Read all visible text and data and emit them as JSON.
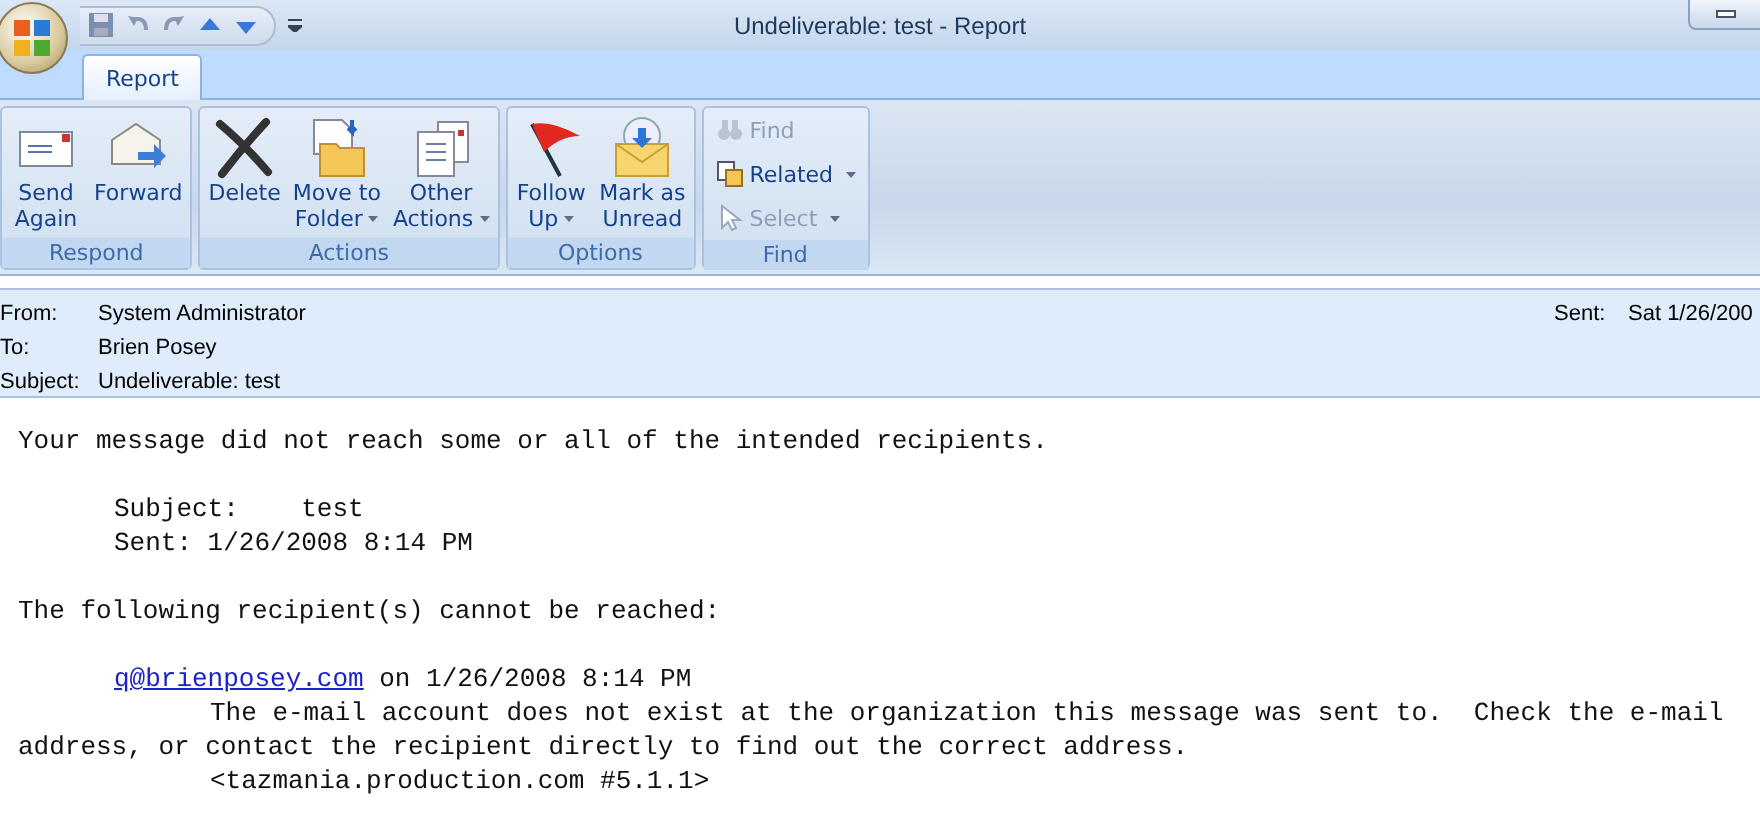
{
  "window": {
    "title": "Undeliverable: test - Report"
  },
  "tabs": [
    {
      "label": "Report",
      "selected": true
    }
  ],
  "ribbon": [
    {
      "label": "Respond",
      "buttons": [
        {
          "lines": [
            "Send",
            "Again"
          ],
          "dropdown": false
        },
        {
          "lines": [
            "Forward"
          ],
          "dropdown": false
        }
      ]
    },
    {
      "label": "Actions",
      "buttons": [
        {
          "lines": [
            "Delete"
          ],
          "dropdown": false
        },
        {
          "lines": [
            "Move to",
            "Folder"
          ],
          "dropdown": true
        },
        {
          "lines": [
            "Other",
            "Actions"
          ],
          "dropdown": true
        }
      ]
    },
    {
      "label": "Options",
      "buttons": [
        {
          "lines": [
            "Follow",
            "Up"
          ],
          "dropdown": true
        },
        {
          "lines": [
            "Mark as",
            "Unread"
          ],
          "dropdown": false
        }
      ]
    },
    {
      "label": "Find",
      "small": [
        {
          "label": "Find",
          "disabled": true,
          "dropdown": false
        },
        {
          "label": "Related",
          "disabled": false,
          "dropdown": true
        },
        {
          "label": "Select",
          "disabled": true,
          "dropdown": true
        }
      ]
    }
  ],
  "header": {
    "from_label": "From:",
    "from": "System Administrator",
    "to_label": "To:",
    "to": "Brien Posey",
    "subject_label": "Subject:",
    "subject": "Undeliverable: test",
    "sent_label": "Sent:",
    "sent": "Sat 1/26/200"
  },
  "body": [
    {
      "kind": "plain",
      "text": "Your message did not reach some or all of the intended recipients."
    },
    {
      "kind": "gap"
    },
    {
      "kind": "indent",
      "text": "Subject:    test"
    },
    {
      "kind": "indent",
      "text": "Sent: 1/26/2008 8:14 PM"
    },
    {
      "kind": "gap"
    },
    {
      "kind": "plain",
      "text": "The following recipient(s) cannot be reached:"
    },
    {
      "kind": "gap"
    },
    {
      "kind": "recipient",
      "link": "q@brienposey.com",
      "text": "on 1/26/2008 8:14 PM"
    },
    {
      "kind": "deep",
      "text": "The e-mail account does not exist at the organization this message was sent to.  Check the e-mail"
    },
    {
      "kind": "plain",
      "text": "address, or contact the recipient directly to find out the correct address."
    },
    {
      "kind": "deep",
      "text": "<tazmania.production.com #5.1.1>"
    }
  ]
}
